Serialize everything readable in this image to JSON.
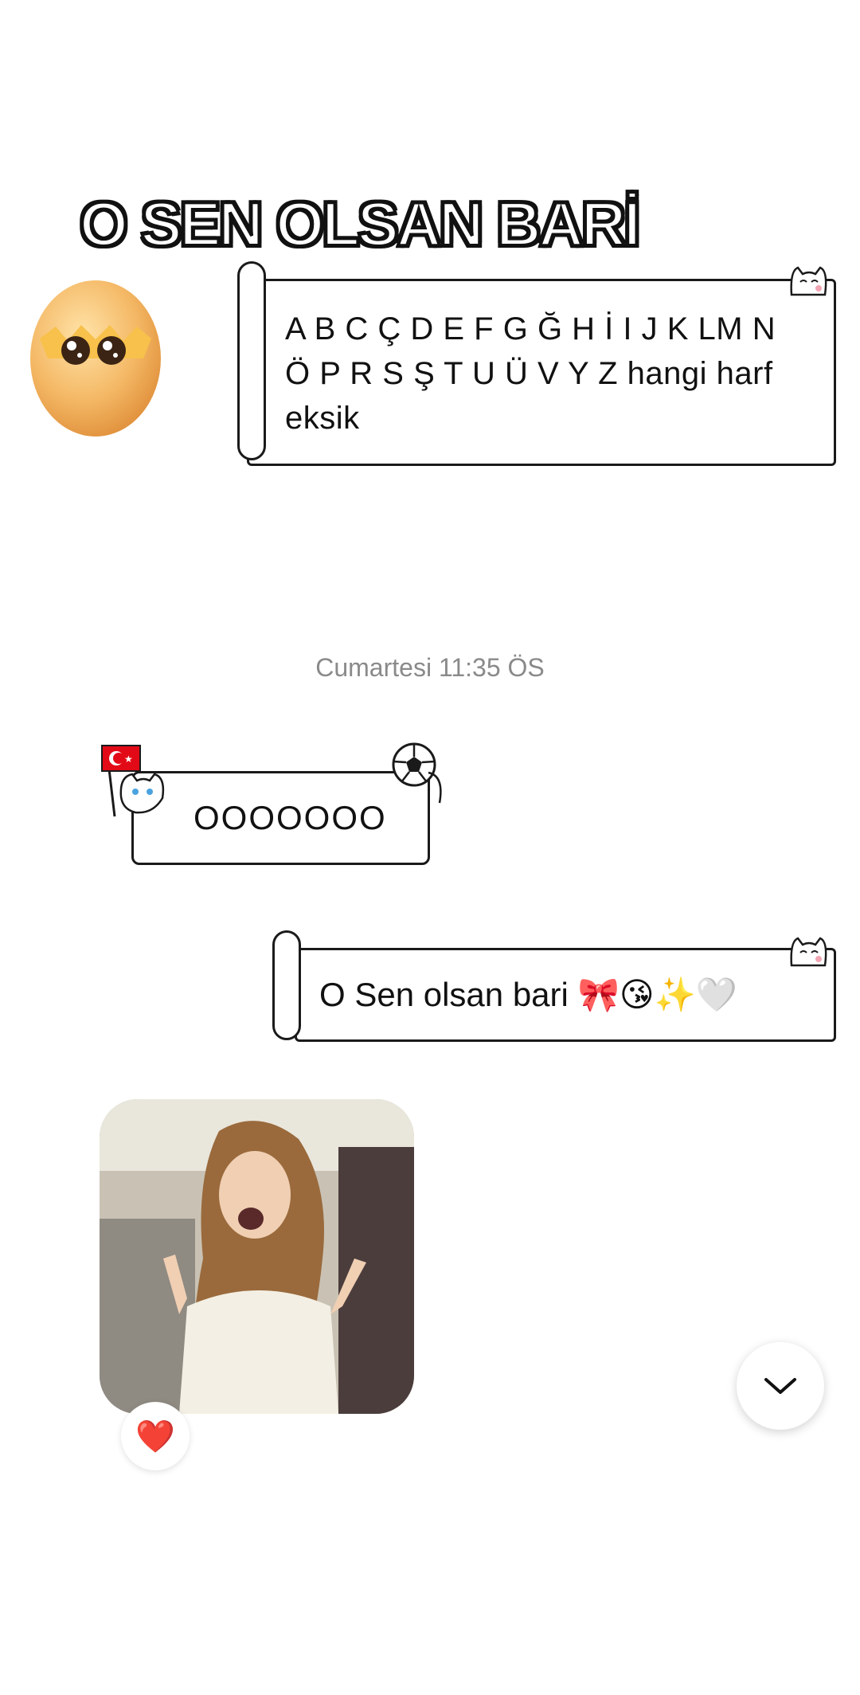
{
  "caption": {
    "text": "O SEN OLSAN BARİ"
  },
  "messages": {
    "incoming_question": "A B C Ç D E F G Ğ H İ I J K LM N Ö P R S Ş T U Ü V Y Z hangi harf eksik",
    "timestamp": "Cumartesi 11:35 ÖS",
    "reply_ooo": "OOOOOOO",
    "outgoing_text": "O Sen olsan bari",
    "outgoing_emojis": "🎀😘✨🤍"
  },
  "reaction": {
    "emoji": "❤️"
  },
  "icons": {
    "avatar": "egg-avatar-icon",
    "scroll_down": "chevron-down-icon",
    "flag": "turkey-flag-icon",
    "ball": "soccer-ball-icon"
  },
  "colors": {
    "flag_red": "#e30a17",
    "heart_red": "#e0202a",
    "timestamp_gray": "#8a8a8a"
  }
}
